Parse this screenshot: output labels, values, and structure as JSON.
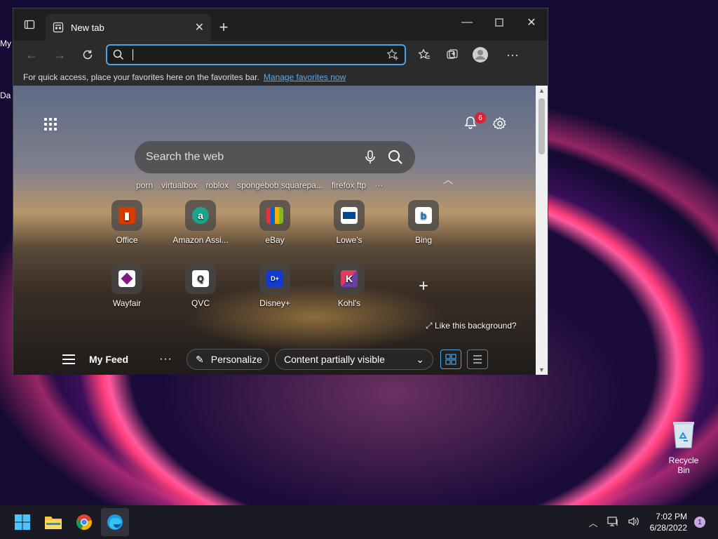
{
  "desktop": {
    "left_labels": [
      "My",
      "Da"
    ],
    "recycle_bin_label": "Recycle Bin"
  },
  "browser": {
    "tab_title": "New tab",
    "address_placeholder": "",
    "favorites_bar_text": "For quick access, place your favorites here on the favorites bar.",
    "manage_favorites_link": "Manage favorites now"
  },
  "newtab": {
    "notification_count": "6",
    "search_placeholder": "Search the web",
    "trending": [
      "porn",
      "virtualbox",
      "roblox",
      "spongebob squarepa...",
      "firefox ftp",
      "···"
    ],
    "tiles": [
      {
        "label": "Office",
        "icon": "office-icon",
        "color": "#d83b01"
      },
      {
        "label": "Amazon Assi...",
        "icon": "amazon-assistant-icon",
        "color": "#1aa58b"
      },
      {
        "label": "eBay",
        "icon": "ebay-icon",
        "color": "#e53238"
      },
      {
        "label": "Lowe's",
        "icon": "lowes-icon",
        "color": "#004990"
      },
      {
        "label": "Bing",
        "icon": "bing-icon",
        "color": "#0078d4"
      },
      {
        "label": "Wayfair",
        "icon": "wayfair-icon",
        "color": "#7f187f"
      },
      {
        "label": "QVC",
        "icon": "qvc-icon",
        "color": "#ffffff"
      },
      {
        "label": "Disney+",
        "icon": "disney-plus-icon",
        "color": "#113ccf"
      },
      {
        "label": "Kohl's",
        "icon": "kohls-icon",
        "color": "#e03a5c"
      }
    ],
    "like_background": "Like this background?",
    "feed": {
      "title": "My Feed",
      "more": "···",
      "personalize": "Personalize",
      "visibility": "Content partially visible"
    }
  },
  "taskbar": {
    "time": "7:02 PM",
    "date": "6/28/2022",
    "notification_count": "1"
  },
  "colors": {
    "accent": "#4aa3e6",
    "badge_red": "#d22233"
  }
}
